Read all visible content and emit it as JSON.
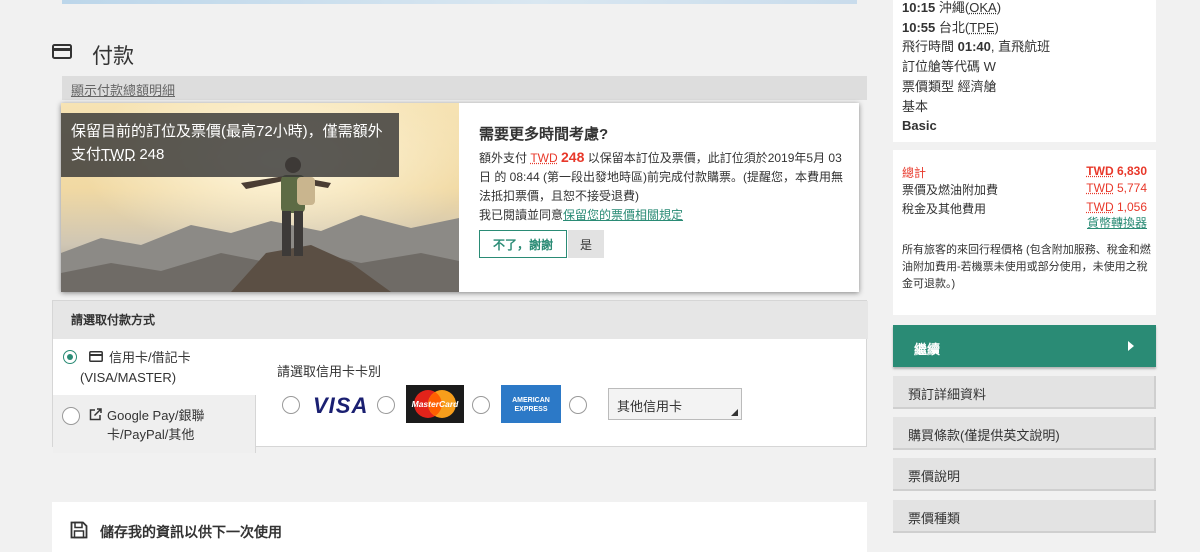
{
  "payment": {
    "title": "付款",
    "summary_link": "顯示付款總額明細"
  },
  "hold": {
    "overlay_text": "保留目前的訂位及票價(最高72小時)，僅需額外支付",
    "overlay_currency": "TWD",
    "overlay_amount": " 248",
    "heading": "需要更多時間考慮?",
    "body_prefix": "額外支付 ",
    "body_currency": "TWD",
    "body_amount": "248",
    "body_text": " 以保留本訂位及票價，此訂位須於2019年5月 03日 的 08:44 (第一段出發地時區)前完成付款購票。(提醒您，本費用無法抵扣票價，且恕不接受退費)",
    "agree_prefix": "我已閱讀並同意",
    "agree_link": "保留您的票價相關規定",
    "no_button": "不了，謝謝",
    "yes_button": "是"
  },
  "methods": {
    "header": "請選取付款方式",
    "tab_card": "信用卡/借記卡",
    "tab_card_sub": "(VISA/MASTER)",
    "tab_other": "Google Pay/銀聯卡/PayPal/其他",
    "card_prompt": "請選取信用卡卡別",
    "brand_visa": "VISA",
    "brand_mastercard": "MasterCard",
    "brand_amex_line1": "AMERICAN",
    "brand_amex_line2": "EXPRESS",
    "other_card": "其他信用卡"
  },
  "save": {
    "label": "儲存我的資訊以供下一次使用"
  },
  "flight": {
    "dep_time": "10:15",
    "dep_city": "沖繩(",
    "dep_code": "OKA",
    "arr_time": "10:55",
    "arr_city": "台北(",
    "arr_code": "TPE",
    "duration_label": "飛行時間 ",
    "duration": "01:40",
    "duration_suffix": ", 直飛航班",
    "booking_class": "訂位艙等代碼 W",
    "fare_type_label": "票價類型 ",
    "fare_type": "經濟艙",
    "fare_basic_zh": "基本",
    "fare_basic_en": "Basic"
  },
  "totals": {
    "total_label": "總計",
    "total_currency": "TWD",
    "total_amount": " 6,830",
    "fare_label": "票價及燃油附加費",
    "fare_currency": "TWD",
    "fare_amount": " 5,774",
    "tax_label": "稅金及其他費用",
    "tax_currency": "TWD",
    "tax_amount": " 1,056",
    "convert_link": "貨幣轉換器",
    "fine_print": "所有旅客的來回行程價格 (包含附加服務、稅金和燃油附加費用-若機票未使用或部分使用，未使用之稅金可退款。)"
  },
  "sidebar": {
    "continue": "繼續",
    "buttons": [
      "預訂詳細資料",
      "購買條款(僅提供英文說明)",
      "票價說明",
      "票價種類"
    ]
  },
  "colors": {
    "brand_green": "#2a8b75",
    "price_red": "#e8382a"
  }
}
